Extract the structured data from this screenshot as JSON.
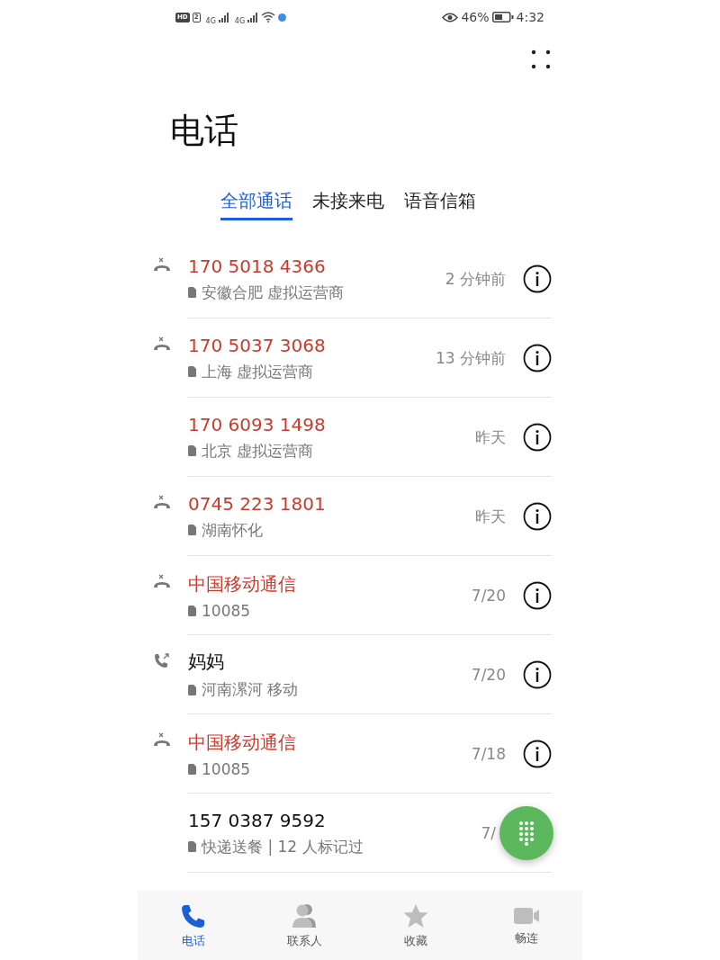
{
  "status_bar": {
    "sim_badges": [
      "HD",
      "2"
    ],
    "network_labels": [
      "4G",
      "4G"
    ],
    "battery": "46%",
    "time": "4:32"
  },
  "title": "电话",
  "tabs": [
    {
      "label": "全部通话",
      "selected": true
    },
    {
      "label": "未接来电",
      "selected": false
    },
    {
      "label": "语音信箱",
      "selected": false
    }
  ],
  "calls": [
    {
      "kind": "missed",
      "name": "170 5018 4366",
      "missed": true,
      "detail": "安徽合肥 虚拟运营商",
      "time": "2 分钟前"
    },
    {
      "kind": "missed",
      "name": "170 5037 3068",
      "missed": true,
      "detail": "上海 虚拟运营商",
      "time": "13 分钟前"
    },
    {
      "kind": "none",
      "name": "170 6093 1498",
      "missed": true,
      "detail": "北京 虚拟运营商",
      "time": "昨天"
    },
    {
      "kind": "missed",
      "name": "0745 223 1801",
      "missed": true,
      "detail": "湖南怀化",
      "time": "昨天"
    },
    {
      "kind": "missed",
      "name": "中国移动通信",
      "missed": true,
      "detail": "10085",
      "time": "7/20"
    },
    {
      "kind": "outgoing",
      "name": "妈妈",
      "missed": false,
      "detail": "河南漯河 移动",
      "time": "7/20"
    },
    {
      "kind": "missed",
      "name": "中国移动通信",
      "missed": true,
      "detail": "10085",
      "time": "7/18"
    },
    {
      "kind": "none",
      "name": "157 0387 9592",
      "missed": false,
      "detail": "快递送餐 | 12 人标记过",
      "time": "7/",
      "info_shown": false
    }
  ],
  "nav": [
    {
      "kind": "phone",
      "label": "电话",
      "selected": true
    },
    {
      "kind": "contacts",
      "label": "联系人",
      "selected": false
    },
    {
      "kind": "favorites",
      "label": "收藏",
      "selected": false
    },
    {
      "kind": "video",
      "label": "畅连",
      "selected": false
    }
  ]
}
